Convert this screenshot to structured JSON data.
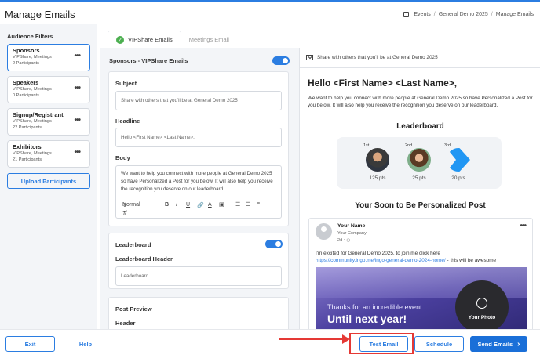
{
  "page": {
    "title": "Manage Emails"
  },
  "breadcrumb": [
    "Events",
    "General Demo 2025",
    "Manage Emails"
  ],
  "sidebar": {
    "title": "Audience Filters",
    "upload_label": "Upload Participants",
    "items": [
      {
        "name": "Sponsors",
        "type": "VIPShare, Meetings",
        "count": "2 Participants",
        "selected": true
      },
      {
        "name": "Speakers",
        "type": "VIPShare, Meetings",
        "count": "0 Participants",
        "selected": false
      },
      {
        "name": "Signup/Registrant",
        "type": "VIPShare, Meetings",
        "count": "22 Participants",
        "selected": false
      },
      {
        "name": "Exhibitors",
        "type": "VIPShare, Meetings",
        "count": "21 Participants",
        "selected": false
      }
    ]
  },
  "tabs": [
    {
      "label": "VIPShare Emails",
      "active": true
    },
    {
      "label": "Meetings Email",
      "active": false
    }
  ],
  "editor": {
    "section_title": "Sponsors - VIPShare Emails",
    "subject_label": "Subject",
    "subject_value": "Share with others that you'll be at General Demo 2025",
    "headline_label": "Headline",
    "headline_value": "Hello <First Name> <Last Name>,",
    "body_label": "Body",
    "body_value": "We want to help you connect with more people at General Demo 2025 so have Personalized a Post for you below. It will also help you receive the recognition you deserve on our leaderboard.",
    "format_value": "Normal",
    "leaderboard_label": "Leaderboard",
    "leaderboard_header_label": "Leaderboard Header",
    "leaderboard_header_value": "Leaderboard",
    "post_preview_label": "Post Preview",
    "header_label": "Header"
  },
  "preview": {
    "subject": "Share with others that you'll be at General Demo 2025",
    "hello": "Hello <First Name> <Last Name>,",
    "intro": "We want to help you connect with more people at General Demo 2025 so have Personalized a Post for you below. It will also help you receive the recognition you deserve on our leaderboard.",
    "leaderboard_title": "Leaderboard",
    "ranks": [
      {
        "pos": "1st",
        "pts": "125 pts"
      },
      {
        "pos": "2nd",
        "pts": "25 pts"
      },
      {
        "pos": "3rd",
        "pts": "20 pts"
      }
    ],
    "post_title": "Your Soon to Be Personalized Post",
    "post": {
      "name": "Your Name",
      "company": "Your Company",
      "time": "2d •",
      "text": "I'm excited for General Demo 2025, to join me click here",
      "link": "https://community.ingo.me/ingo-general-demo-2024-home/",
      "link_suffix": " - this will be awesome",
      "img_line1": "Thanks for an incredible event",
      "img_line2": "Until next year!",
      "photo_label": "Your Photo"
    }
  },
  "footer": {
    "exit": "Exit",
    "help": "Help",
    "test_email": "Test Email",
    "schedule": "Schedule",
    "send": "Send Emails"
  },
  "colors": {
    "accent": "#2b7de1",
    "highlight": "#e53935",
    "success": "#4caf50"
  }
}
